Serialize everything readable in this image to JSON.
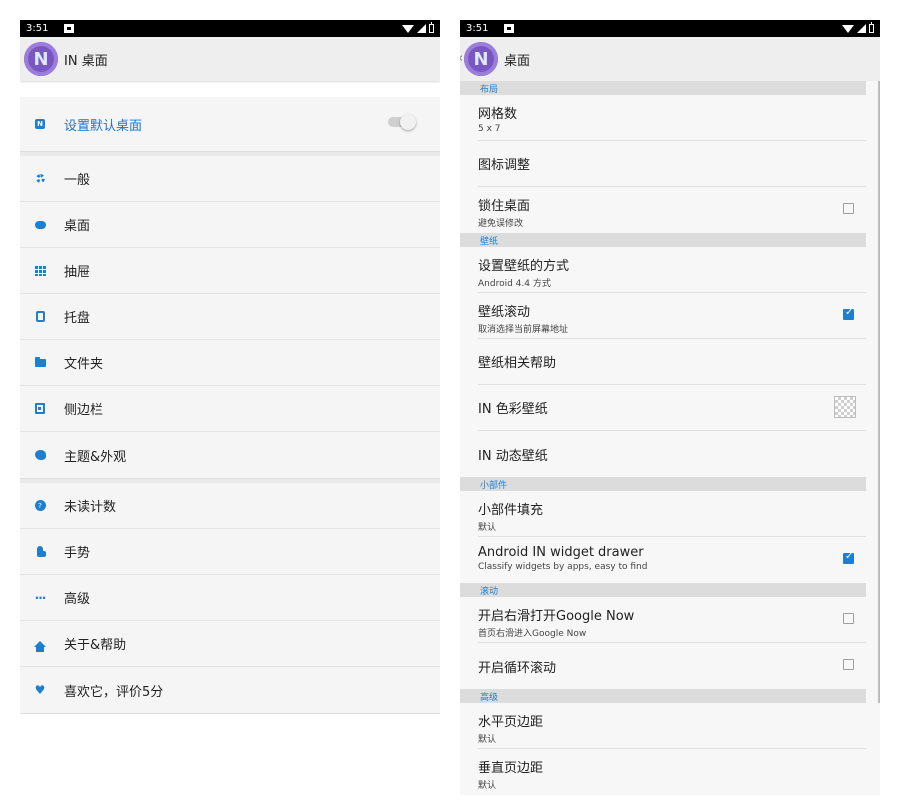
{
  "left": {
    "statusbar": {
      "time": "3:51"
    },
    "appbar": {
      "logo_letter": "N",
      "title": "IN 桌面"
    },
    "menu": {
      "default_launcher": "设置默认桌面",
      "items_a": [
        "一般",
        "桌面",
        "抽屉",
        "托盘",
        "文件夹",
        "侧边栏",
        "主题&外观"
      ],
      "items_b": [
        "未读计数",
        "手势",
        "高级",
        "关于&帮助",
        "喜欢它，评价5分"
      ]
    },
    "icons": [
      "launcher-icon",
      "gear-icon",
      "desktop-icon",
      "grid-icon",
      "tablet-icon",
      "folder-icon",
      "sidebar-icon",
      "palette-icon",
      "badge-icon",
      "hand-icon",
      "more-dots-icon",
      "home-icon",
      "heart-icon"
    ]
  },
  "right": {
    "statusbar": {
      "time": "3:51"
    },
    "appbar": {
      "logo_letter": "N",
      "title": "桌面",
      "back": "‹"
    },
    "sections": {
      "layout": "布局",
      "wallpaper": "壁纸",
      "widget": "小部件",
      "scroll": "滚动",
      "advanced": "高级"
    },
    "items": {
      "grid_title": "网格数",
      "grid_value": "5 x 7",
      "icon_adjust": "图标调整",
      "lock_title": "锁住桌面",
      "lock_sub": "避免误修改",
      "wp_method_title": "设置壁纸的方式",
      "wp_method_sub": "Android 4.4 方式",
      "wp_scroll_title": "壁纸滚动",
      "wp_scroll_sub": "取消选择当前屏幕地址",
      "wp_help": "壁纸相关帮助",
      "color_wp": "IN 色彩壁纸",
      "live_wp": "IN 动态壁纸",
      "widget_pad_title": "小部件填充",
      "widget_pad_sub": "默认",
      "widget_drawer_title": "Android IN widget drawer",
      "widget_drawer_sub": "Classify widgets by apps, easy to find",
      "gnow_title": "开启右滑打开Google Now",
      "gnow_sub": "首页右滑进入Google Now",
      "loop_title": "开启循环滚动",
      "hmargin_title": "水平页边距",
      "hmargin_sub": "默认",
      "vmargin_title": "垂直页边距",
      "vmargin_sub": "默认"
    },
    "states": {
      "lock_checked": false,
      "wp_scroll_checked": true,
      "widget_drawer_checked": true,
      "gnow_checked": false,
      "loop_checked": false
    }
  },
  "colors": {
    "accent": "#1e7fd0",
    "logo": "#7a56c2",
    "appbar": "#eeeeee",
    "section_header": "#dcdcdc"
  }
}
